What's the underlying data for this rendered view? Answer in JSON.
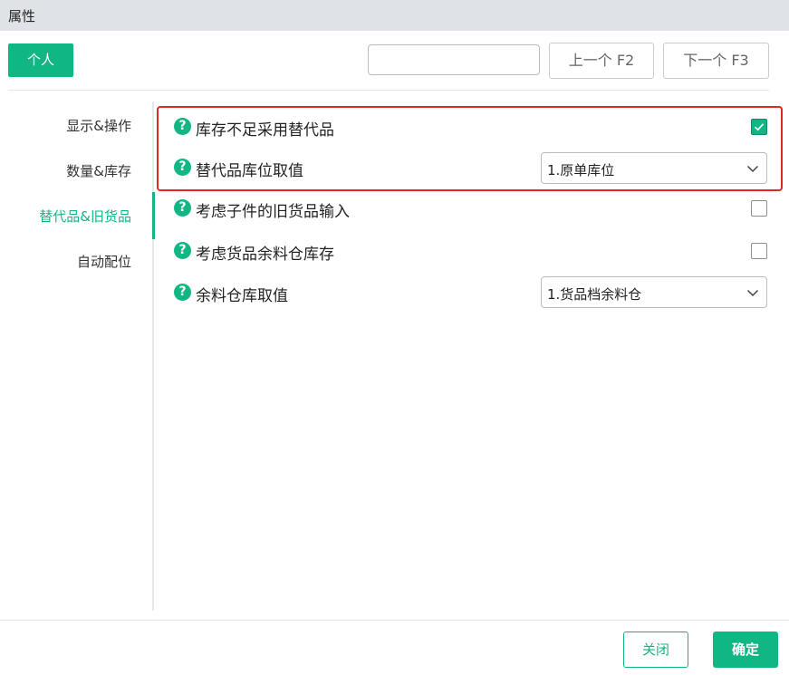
{
  "window": {
    "title": "属性"
  },
  "toolbar": {
    "personal_label": "个人",
    "search": {
      "value": "",
      "placeholder": ""
    },
    "prev_label": "上一个 F2",
    "next_label": "下一个 F3"
  },
  "sidebar": {
    "items": [
      {
        "label": "显示&操作",
        "active": false
      },
      {
        "label": "数量&库存",
        "active": false
      },
      {
        "label": "替代品&旧货品",
        "active": true
      },
      {
        "label": "自动配位",
        "active": false
      }
    ]
  },
  "settings": [
    {
      "label": "库存不足采用替代品",
      "type": "checkbox",
      "checked": true,
      "help_icon": "question-circle-icon"
    },
    {
      "label": "替代品库位取值",
      "type": "select",
      "value": "1.原单库位",
      "help_icon": "question-circle-icon"
    },
    {
      "label": "考虑子件的旧货品输入",
      "type": "checkbox",
      "checked": false,
      "help_icon": "question-circle-icon"
    },
    {
      "label": "考虑货品余料仓库存",
      "type": "checkbox",
      "checked": false,
      "help_icon": "question-circle-icon"
    },
    {
      "label": "余料仓库取值",
      "type": "select",
      "value": "1.货品档余料仓",
      "help_icon": "question-circle-icon"
    }
  ],
  "help_glyph": "?",
  "footer": {
    "close_label": "关闭",
    "ok_label": "确定"
  },
  "colors": {
    "accent": "#10b784",
    "highlight": "#e02a21",
    "titlebar": "#dfe3e7"
  }
}
